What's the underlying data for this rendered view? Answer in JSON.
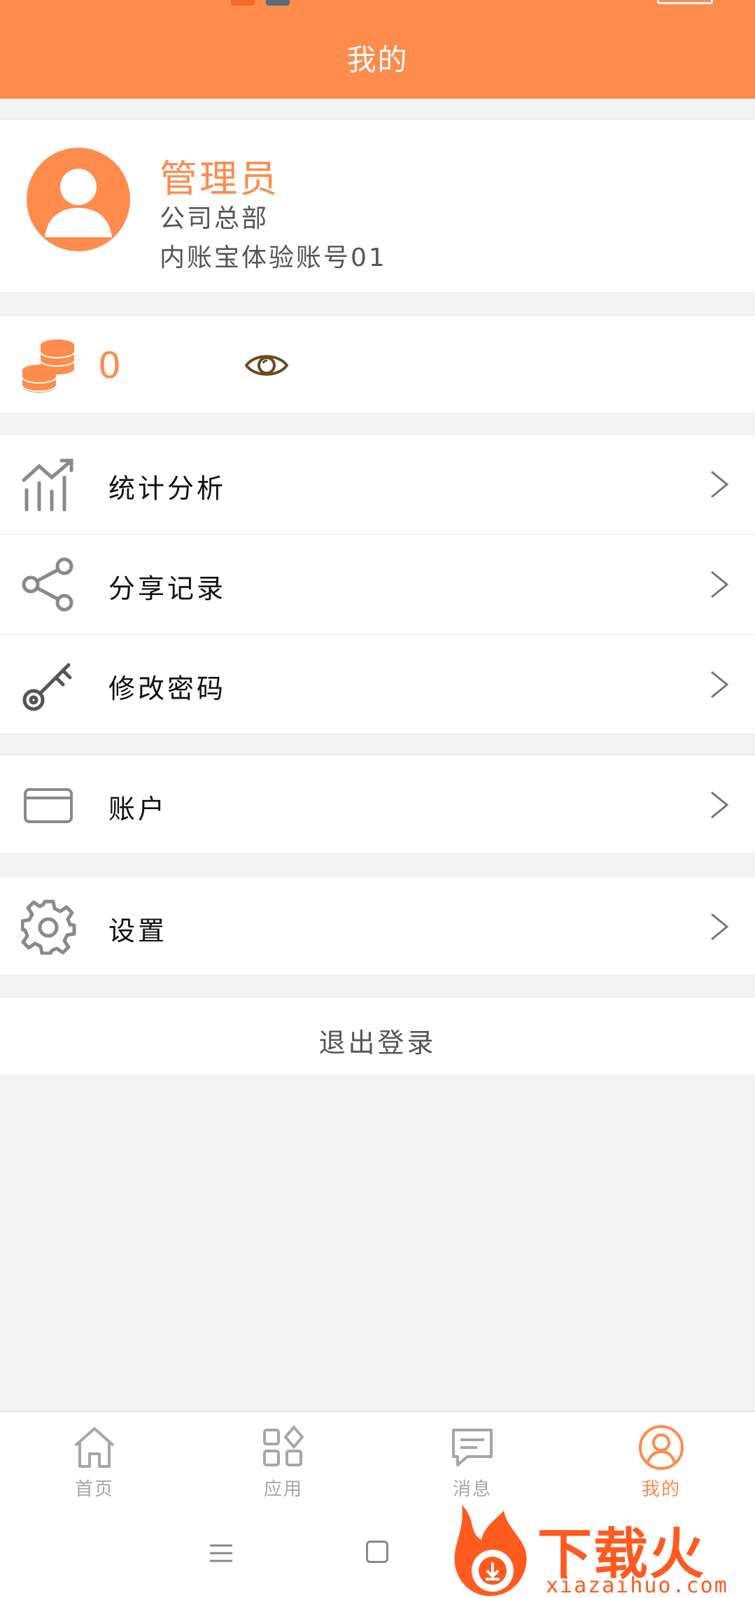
{
  "header": {
    "title": "我的"
  },
  "profile": {
    "name": "管理员",
    "department": "公司总部",
    "account": "内账宝体验账号01"
  },
  "coins": {
    "value": "0"
  },
  "menu": {
    "group1": [
      {
        "label": "统计分析",
        "icon": "chart-icon"
      },
      {
        "label": "分享记录",
        "icon": "share-icon"
      },
      {
        "label": "修改密码",
        "icon": "key-icon"
      }
    ],
    "group2": [
      {
        "label": "账户",
        "icon": "card-icon"
      }
    ],
    "group3": [
      {
        "label": "设置",
        "icon": "gear-icon"
      }
    ]
  },
  "logout": {
    "label": "退出登录"
  },
  "tabs": [
    {
      "label": "首页",
      "icon": "home-icon",
      "active": false
    },
    {
      "label": "应用",
      "icon": "apps-icon",
      "active": false
    },
    {
      "label": "消息",
      "icon": "message-icon",
      "active": false
    },
    {
      "label": "我的",
      "icon": "user-icon",
      "active": true
    }
  ],
  "watermark": {
    "text": "下载火",
    "sub": "xiazaihuo.com"
  },
  "colors": {
    "accent": "#ff8b4c",
    "inactive": "#a6a6a6"
  }
}
